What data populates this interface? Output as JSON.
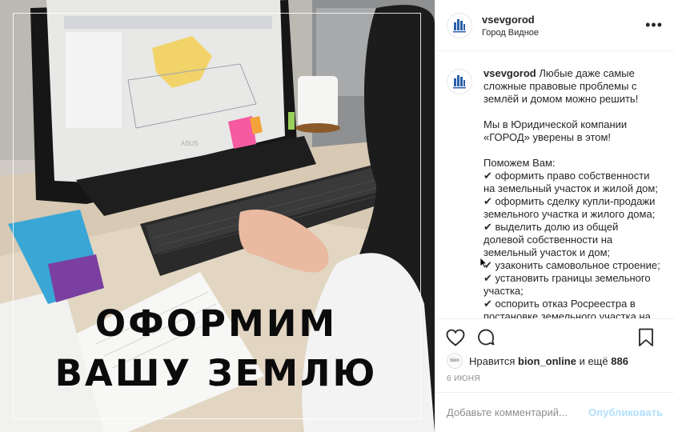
{
  "post": {
    "username": "vsevgorod",
    "location": "Город Видное",
    "more_label": "•••",
    "image_headline_line1": "ОФОРМИМ",
    "image_headline_line2": "ВАШУ ЗЕМЛЮ",
    "caption_lines": [
      "Любые даже самые сложные правовые проблемы с землёй и домом можно решить!",
      "",
      "Мы в Юридической компании «ГОРОД» уверены в этом!",
      "",
      "Поможем Вам:",
      "✔ оформить право собственности на земельный участок и жилой дом;",
      "✔ оформить сделку купли-продажи земельного участка и жилого дома;",
      "✔ выделить долю из общей долевой собственности на земельный участок и дом;",
      "✔ узаконить самовольное строение;",
      "✔ установить границы земельного участка;",
      "✔ оспорить отказ Росреестра в постановке земельного участка на"
    ],
    "likes_prefix": "Нравится",
    "likes_user": "bion_online",
    "likes_suffix": "и ещё",
    "likes_count": "886",
    "liker_avatar_text": "bion",
    "date": "6 ИЮНЯ",
    "comment_placeholder": "Добавьте комментарий...",
    "publish_label": "Опубликовать"
  },
  "icons": {
    "more": "ellipsis-icon",
    "like": "heart-icon",
    "comment": "comment-bubble-icon",
    "save": "bookmark-icon",
    "avatar": "company-logo-icon"
  },
  "colors": {
    "brand_logo": "#2b5fa8",
    "publish_disabled": "#b2dffc",
    "muted_text": "#8e8e8e",
    "border": "#efefef"
  }
}
